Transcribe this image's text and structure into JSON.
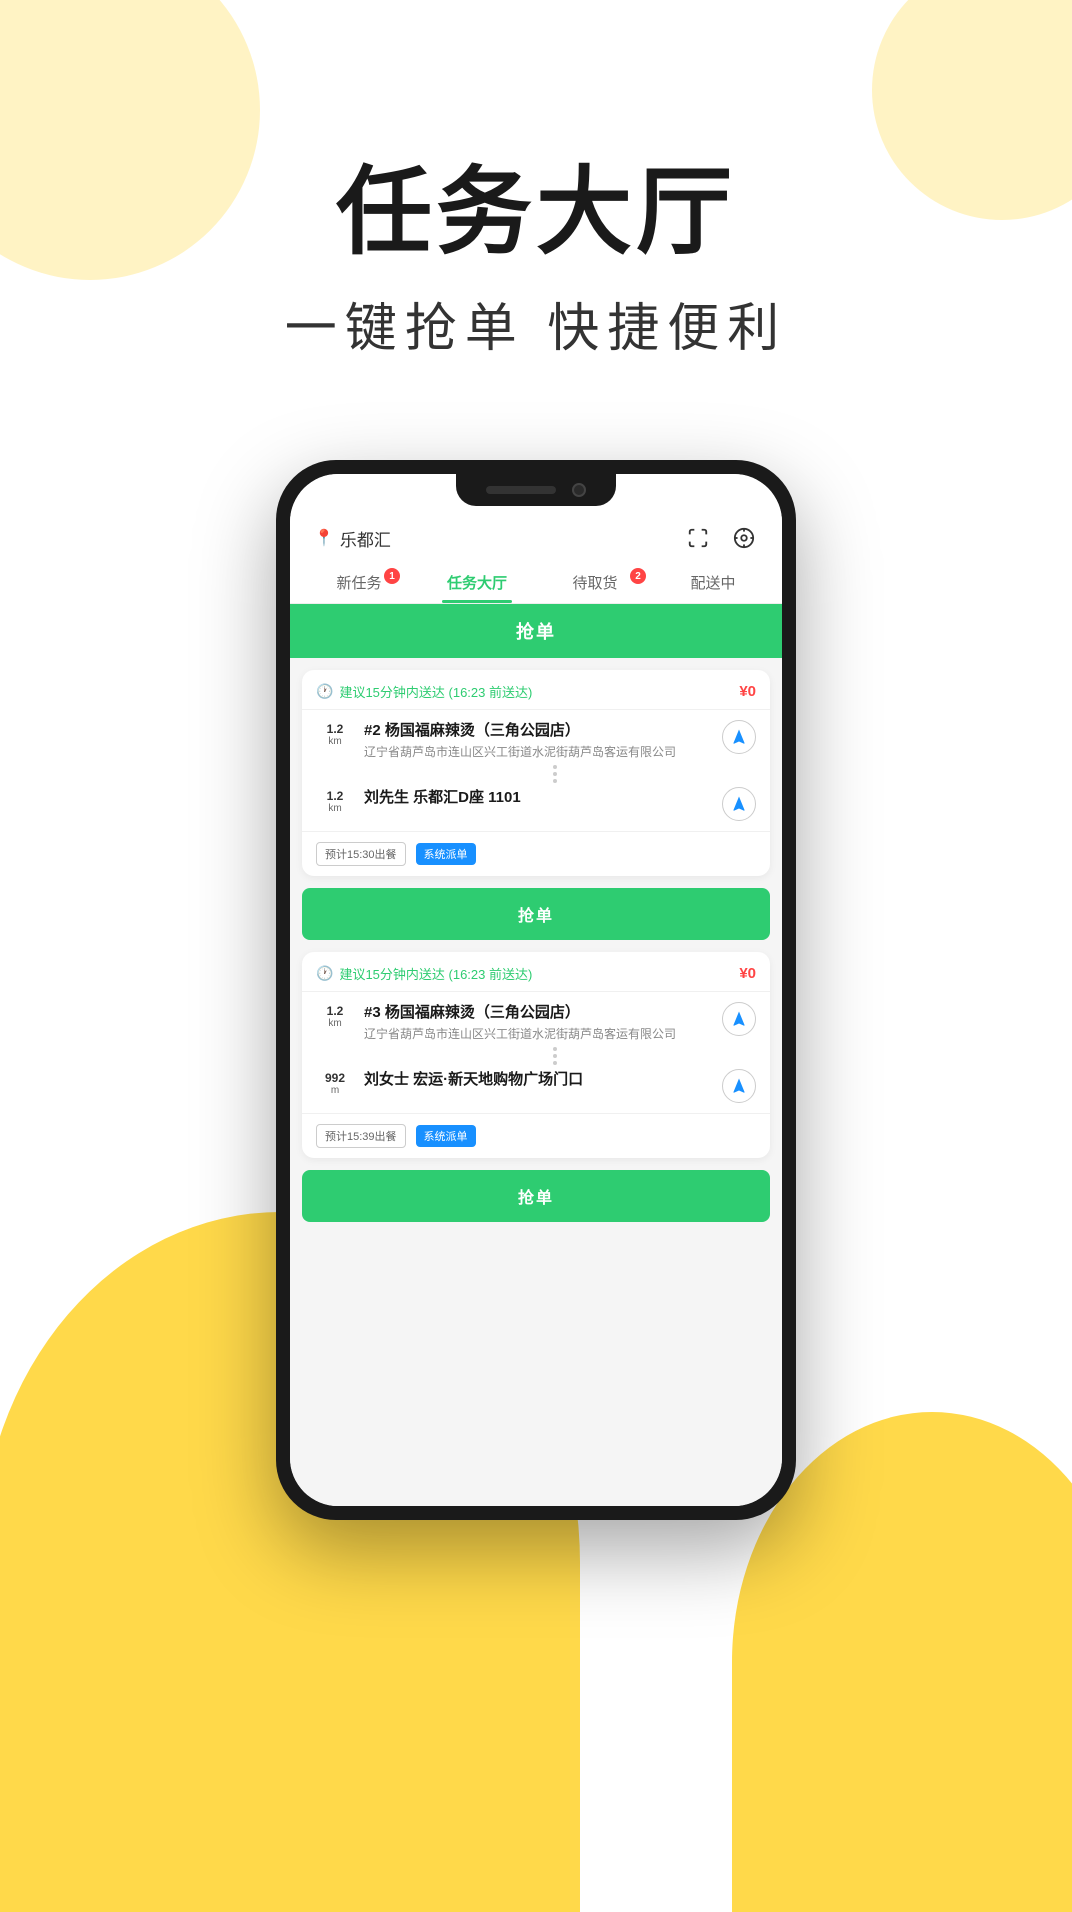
{
  "page": {
    "background_circles": {
      "top_left_color": "#FFF3C4",
      "top_right_color": "#FFF3C4",
      "bottom_yellow_color": "#FFD94A"
    },
    "header": {
      "main_title": "任务大厅",
      "sub_title": "一键抢单 快捷便利"
    },
    "phone": {
      "app": {
        "location": "乐都汇",
        "tabs": [
          {
            "label": "新任务",
            "badge": "1",
            "active": false
          },
          {
            "label": "任务大厅",
            "badge": null,
            "active": true
          },
          {
            "label": "待取货",
            "badge": "2",
            "active": false
          },
          {
            "label": "配送中",
            "badge": null,
            "active": false
          }
        ],
        "grab_top_label": "抢单",
        "orders": [
          {
            "time_suggestion": "建议15分钟内送达 (16:23 前送达)",
            "price": "¥0",
            "stops": [
              {
                "distance": "1.2",
                "unit": "km",
                "name": "#2 杨国福麻辣烫（三角公园店）",
                "address": "辽宁省葫芦岛市连山区兴工街道水泥街葫芦岛客运有限公司",
                "has_nav": true
              },
              {
                "distance": "1.2",
                "unit": "km",
                "name": "刘先生 乐都汇D座 1101",
                "address": null,
                "has_nav": true
              }
            ],
            "footer_tags": [
              "预计15:30出餐",
              "系统派单"
            ],
            "grab_label": "抢单"
          },
          {
            "time_suggestion": "建议15分钟内送达 (16:23 前送达)",
            "price": "¥0",
            "stops": [
              {
                "distance": "1.2",
                "unit": "km",
                "name": "#3 杨国福麻辣烫（三角公园店）",
                "address": "辽宁省葫芦岛市连山区兴工街道水泥街葫芦岛客运有限公司",
                "has_nav": true
              },
              {
                "distance": "992",
                "unit": "m",
                "name": "刘女士 宏运·新天地购物广场门口",
                "address": null,
                "has_nav": true
              }
            ],
            "footer_tags": [
              "预计15:39出餐",
              "系统派单"
            ],
            "grab_label": "抢单"
          }
        ]
      }
    }
  }
}
